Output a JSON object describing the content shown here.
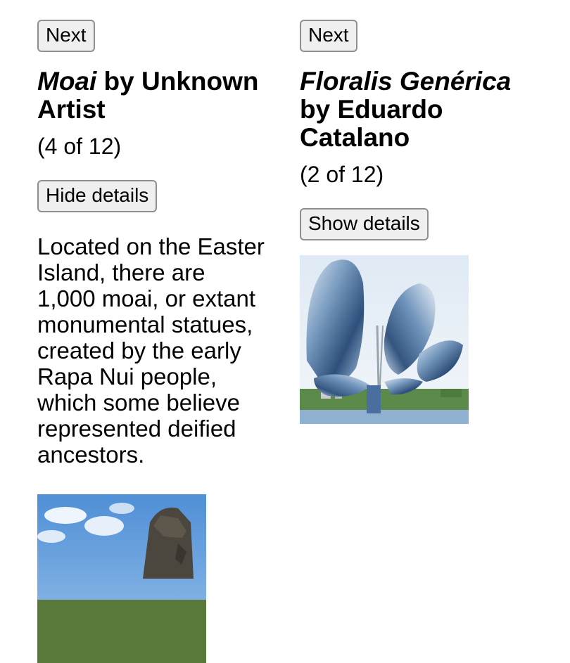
{
  "left": {
    "next_label": "Next",
    "title_italic": "Moai",
    "title_rest": " by Unknown Artist",
    "counter": "(4 of 12)",
    "toggle_label": "Hide details",
    "description": "Located on the Easter Island, there are 1,000 moai, or extant monumental statues, created by the early Rapa Nui people, which some believe represented deified ancestors.",
    "image_icon": "moai-photo"
  },
  "right": {
    "next_label": "Next",
    "title_italic": "Floralis Genérica",
    "title_rest": " by Eduardo Catalano",
    "counter": "(2 of 12)",
    "toggle_label": "Show details",
    "image_icon": "floralis-generica-photo"
  }
}
